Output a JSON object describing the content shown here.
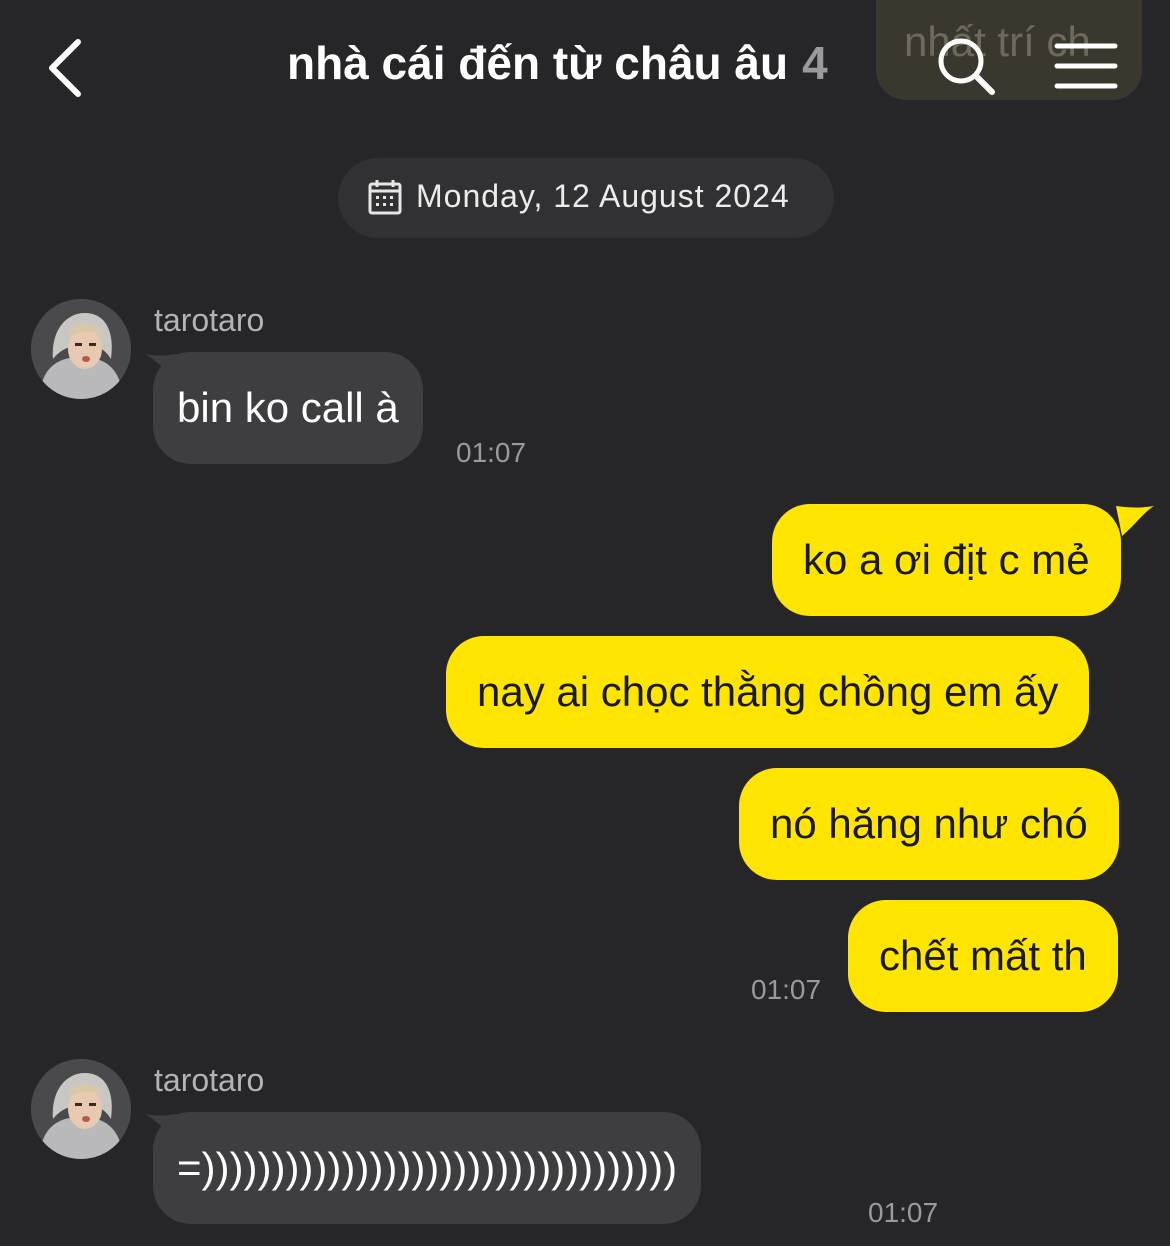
{
  "header": {
    "title": "nhà cái đến từ châu âu",
    "member_count": "4",
    "pinned_notice": "nhất trí ch"
  },
  "date_divider": "Monday, 12 August 2024",
  "messages": [
    {
      "sender": "tarotaro",
      "text": "bin ko call à",
      "time": "01:07"
    },
    {
      "text": "ko a ơi địt c mẻ"
    },
    {
      "text": "nay ai chọc thằng chồng em ấy"
    },
    {
      "text": "nó hăng như chó"
    },
    {
      "text": "chết mất th",
      "time": "01:07"
    },
    {
      "sender": "tarotaro",
      "text": "=))))))))))))))))))))))))))))))))))",
      "time": "01:07"
    }
  ],
  "colors": {
    "background": "#262628",
    "incoming_bubble": "#3e3e40",
    "outgoing_bubble": "#ffe500",
    "timestamp": "#9a9a9c"
  },
  "icons": [
    "back-arrow-icon",
    "search-icon",
    "menu-icon",
    "calendar-icon"
  ]
}
